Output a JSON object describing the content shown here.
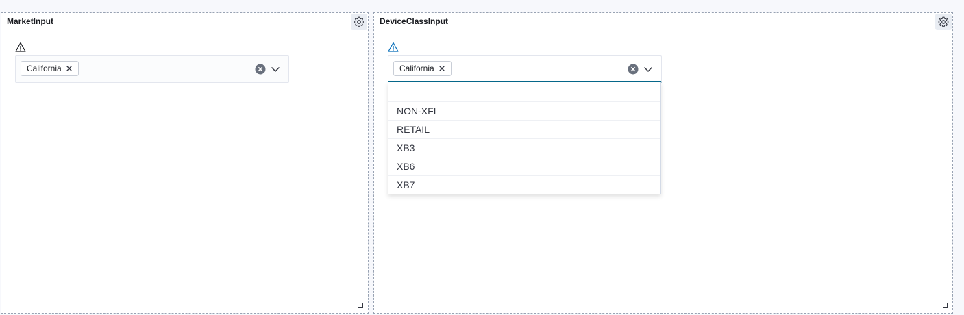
{
  "panels": {
    "market": {
      "title": "MarketInput",
      "combo": {
        "selected": [
          "California"
        ]
      }
    },
    "device": {
      "title": "DeviceClassInput",
      "combo": {
        "selected": [
          "California"
        ],
        "search_value": "",
        "options": [
          "NON-XFI",
          "RETAIL",
          "XB3",
          "XB6",
          "XB7"
        ]
      }
    }
  },
  "icons": {
    "gear": "gear-icon",
    "warning": "warning-icon",
    "clear": "clear-icon",
    "chevron": "chevron-down-icon",
    "remove": "close-icon"
  },
  "colors": {
    "accent": "#07698d",
    "warning_default": "#1a1c21",
    "warning_active": "#006bb8"
  }
}
